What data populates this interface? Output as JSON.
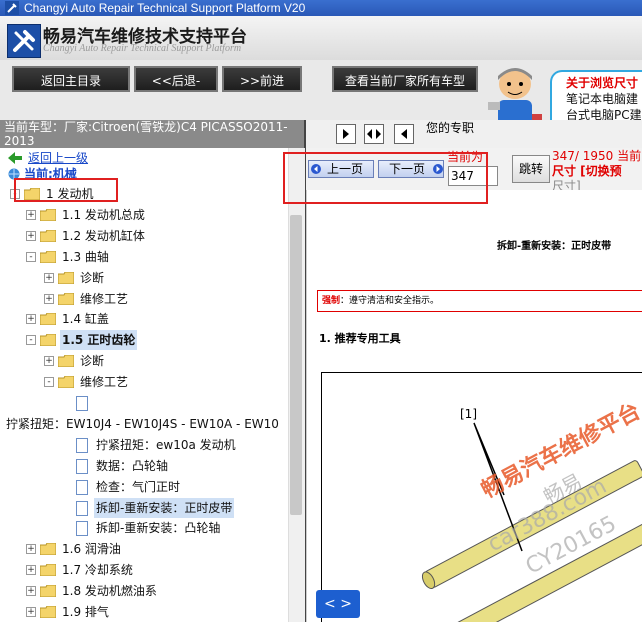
{
  "window": {
    "title": "Changyi Auto Repair Technical Support Platform V20"
  },
  "header": {
    "app_title": "畅易汽车维修技术支持平台",
    "app_subtitle": "Changyi Auto Repair Technical Support Platform"
  },
  "toolbar": {
    "home_label": "返回主目录",
    "back_label": "<<后退-",
    "forward_label": ">>前进",
    "all_models_label": "查看当前厂家所有车型"
  },
  "notice": {
    "line1": "关于浏览尺寸",
    "line2": "笔记本电脑建",
    "line3": "台式电脑PC建"
  },
  "car_info": "当前车型：厂家:Citroen(雪铁龙)C4 PICASSO2011-2013",
  "nav_strip": {
    "user_text": "您的专职"
  },
  "pager": {
    "prev_label": "上一页",
    "next_label": "下一页",
    "current_label": "当前为",
    "page_value": "347",
    "jump_label": "跳转",
    "page_total": "347/ 1950 当前",
    "size_line1": "尺寸 [切换预",
    "size_line2": "尺寸]"
  },
  "tree": {
    "back_up": "返回上一级",
    "current": "当前:机械",
    "items": [
      {
        "label": "1 发动机",
        "level": 0,
        "type": "folder",
        "expand": "-"
      },
      {
        "label": "1.1 发动机总成",
        "level": 1,
        "type": "folder",
        "expand": "+"
      },
      {
        "label": "1.2 发动机缸体",
        "level": 1,
        "type": "folder",
        "expand": "+"
      },
      {
        "label": "1.3 曲轴",
        "level": 1,
        "type": "folder",
        "expand": "-"
      },
      {
        "label": "诊断",
        "level": 2,
        "type": "folder",
        "expand": "+"
      },
      {
        "label": "维修工艺",
        "level": 2,
        "type": "folder",
        "expand": "+"
      },
      {
        "label": "1.4 缸盖",
        "level": 1,
        "type": "folder",
        "expand": "+"
      },
      {
        "label": "1.5 正时齿轮",
        "level": 1,
        "type": "folder",
        "expand": "-",
        "selected": true
      },
      {
        "label": "诊断",
        "level": 2,
        "type": "folder",
        "expand": "+"
      },
      {
        "label": "维修工艺",
        "level": 2,
        "type": "folder",
        "expand": "-"
      },
      {
        "label": "",
        "level": 3,
        "type": "doc"
      },
      {
        "label": "拧紧扭矩：EW10J4 - EW10J4S - EW10A - EW10",
        "level": -1,
        "type": "text"
      },
      {
        "label": "拧紧扭矩：ew10a 发动机",
        "level": 3,
        "type": "doc"
      },
      {
        "label": "数据：凸轮轴",
        "level": 3,
        "type": "doc"
      },
      {
        "label": "检查：气门正时",
        "level": 3,
        "type": "doc"
      },
      {
        "label": "拆卸-重新安装：正时皮带",
        "level": 3,
        "type": "doc",
        "selected": true
      },
      {
        "label": "拆卸-重新安装：凸轮轴",
        "level": 3,
        "type": "doc"
      },
      {
        "label": "1.6 润滑油",
        "level": 1,
        "type": "folder",
        "expand": "+"
      },
      {
        "label": "1.7 冷却系统",
        "level": 1,
        "type": "folder",
        "expand": "+"
      },
      {
        "label": "1.8 发动机燃油系",
        "level": 1,
        "type": "folder",
        "expand": "+"
      },
      {
        "label": "1.9 排气",
        "level": 1,
        "type": "folder",
        "expand": "+"
      }
    ]
  },
  "document": {
    "title": "拆卸-重新安装：正时皮带",
    "warning_label": "强制",
    "warning_text": "：遵守清洁和安全指示。",
    "section1": "1. 推荐专用工具",
    "callout": "[1]",
    "watermark1": "畅易汽车维修平台",
    "watermark2": "car388.com",
    "watermark3": "CY20165",
    "watermark4": "畅易"
  },
  "page_nav": {
    "label": "< >"
  },
  "colors": {
    "accent_blue": "#2a58b6",
    "red_marker": "#e02020",
    "warning_red": "#e00000"
  }
}
